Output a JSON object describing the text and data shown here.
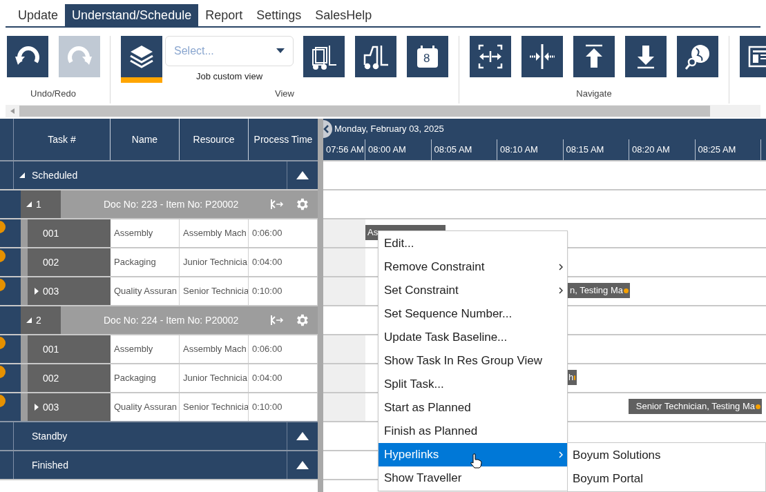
{
  "tabs": [
    {
      "label": "Update",
      "selected": false
    },
    {
      "label": "Understand/Schedule",
      "selected": true
    },
    {
      "label": "Report",
      "selected": false
    },
    {
      "label": "Settings",
      "selected": false
    },
    {
      "label": "SalesHelp",
      "selected": false
    }
  ],
  "ribbon": {
    "groups": [
      {
        "label": "Undo/Redo",
        "items": [
          {
            "kind": "undo",
            "disabled": false,
            "selected": false
          },
          {
            "kind": "redo",
            "disabled": true,
            "selected": false
          }
        ]
      },
      {
        "label": "View",
        "items": [
          {
            "kind": "layers",
            "disabled": false,
            "selected": true
          },
          {
            "kind": "select",
            "placeholder": "Select...",
            "caption": "Job custom view"
          },
          {
            "kind": "forklifts",
            "disabled": false,
            "selected": false
          },
          {
            "kind": "forklift",
            "disabled": false,
            "selected": false
          },
          {
            "kind": "calendar",
            "text": "8",
            "disabled": false,
            "selected": false
          }
        ]
      },
      {
        "label": "Navigate",
        "items": [
          {
            "kind": "fit",
            "disabled": false,
            "selected": false
          },
          {
            "kind": "center",
            "disabled": false,
            "selected": false
          },
          {
            "kind": "top",
            "disabled": false,
            "selected": false
          },
          {
            "kind": "bottom",
            "disabled": false,
            "selected": false
          },
          {
            "kind": "globe",
            "disabled": false,
            "selected": false
          }
        ]
      },
      {
        "items": [
          {
            "kind": "report",
            "disabled": false,
            "selected": false
          }
        ]
      }
    ]
  },
  "grid": {
    "columns": [
      "Task #",
      "Name",
      "Resource",
      "Process Time"
    ],
    "sections": [
      {
        "label": "Scheduled",
        "expanded": true,
        "jobs": [
          {
            "number": "1",
            "title": "Doc No: 223 - Item No: P20002",
            "tasks": [
              {
                "task": "001",
                "name": "Assembly",
                "resource": "Assembly Mach",
                "time": "0:06:00",
                "expandable": false,
                "bar": "As"
              },
              {
                "task": "002",
                "name": "Packaging",
                "resource": "Junior Technicia",
                "time": "0:04:00",
                "expandable": false
              },
              {
                "task": "003",
                "name": "Quality Assuran",
                "resource": "Senior Technicia",
                "time": "0:10:00",
                "expandable": true,
                "bar": "n, Testing Ma"
              }
            ]
          },
          {
            "number": "2",
            "title": "Doc No: 224 - Item No: P20002",
            "tasks": [
              {
                "task": "001",
                "name": "Assembly",
                "resource": "Assembly Mach",
                "time": "0:06:00",
                "expandable": false
              },
              {
                "task": "002",
                "name": "Packaging",
                "resource": "Junior Technicia",
                "time": "0:04:00",
                "expandable": false,
                "bar": "h"
              },
              {
                "task": "003",
                "name": "Quality Assuran",
                "resource": "Senior Technicia",
                "time": "0:10:00",
                "expandable": true,
                "bar": "Senior Technician, Testing Ma"
              }
            ]
          }
        ]
      },
      {
        "label": "Standby",
        "expanded": false
      },
      {
        "label": "Finished",
        "expanded": false
      }
    ]
  },
  "timeline": {
    "date": "Monday, February 03, 2025",
    "times": [
      "07:56 AM",
      "08:00 AM",
      "08:05 AM",
      "08:10 AM",
      "08:15 AM",
      "08:20 AM",
      "08:25 AM"
    ]
  },
  "context_menu": {
    "items": [
      {
        "label": "Edit...",
        "submenu": false,
        "selected": false
      },
      {
        "label": "Remove Constraint",
        "submenu": true,
        "selected": false
      },
      {
        "label": "Set Constraint",
        "submenu": true,
        "selected": false
      },
      {
        "label": "Set Sequence Number...",
        "submenu": false,
        "selected": false
      },
      {
        "label": "Update Task Baseline...",
        "submenu": false,
        "selected": false
      },
      {
        "label": "Show Task In Res Group View",
        "submenu": false,
        "selected": false
      },
      {
        "label": "Split Task...",
        "submenu": false,
        "selected": false
      },
      {
        "label": "Start as Planned",
        "submenu": false,
        "selected": false
      },
      {
        "label": "Finish as Planned",
        "submenu": false,
        "selected": false
      },
      {
        "label": "Hyperlinks",
        "submenu": true,
        "selected": true
      },
      {
        "label": "Show Traveller",
        "submenu": false,
        "selected": false
      }
    ],
    "submenu": [
      "Boyum Solutions",
      "Boyum Portal"
    ]
  }
}
